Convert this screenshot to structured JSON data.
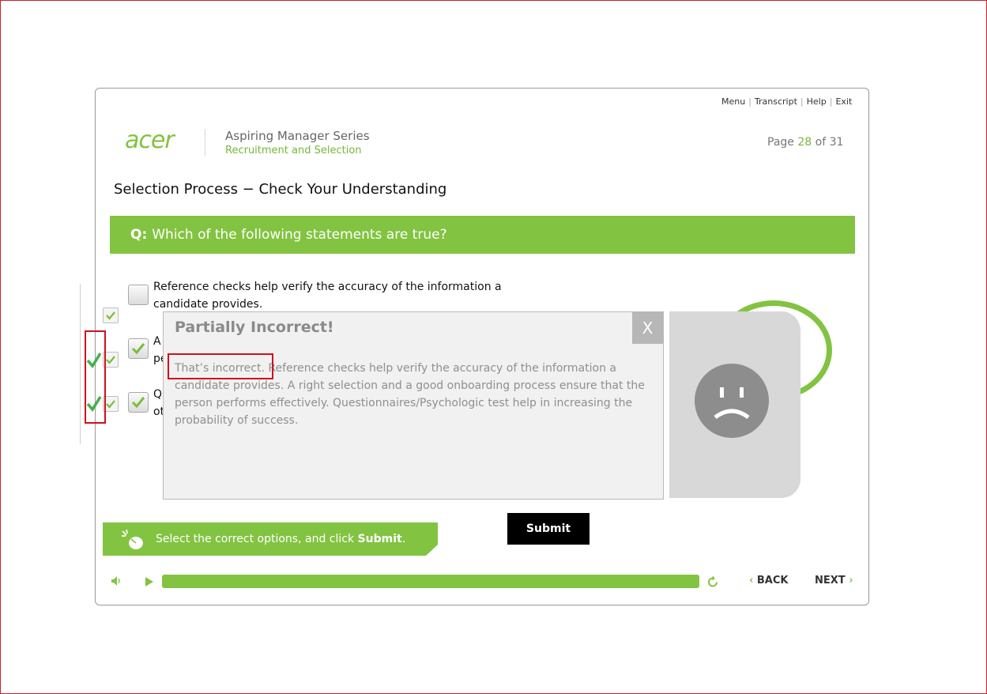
{
  "topnav": {
    "menu": "Menu",
    "transcript": "Transcript",
    "help": "Help",
    "exit": "Exit"
  },
  "brand": {
    "logo": "acer",
    "series": "Aspiring Manager Series",
    "module": "Recruitment and Selection"
  },
  "page": {
    "label": "Page",
    "current": "28",
    "of": "of",
    "total": "31"
  },
  "title": "Selection Process − Check Your Understanding",
  "question": {
    "prefix": "Q:",
    "text": "Which of the following statements are true?"
  },
  "options": [
    {
      "text": "Reference checks help verify the accuracy of the information a candidate provides.",
      "checked": false
    },
    {
      "text": "A\npe",
      "checked": true
    },
    {
      "text": "Q\not",
      "checked": true
    }
  ],
  "feedback": {
    "title": "Partially Incorrect!",
    "close": "X",
    "lead": "That’s incorrect.",
    "body": "Reference checks help verify the accuracy of the information a candidate provides. A right selection and a good onboarding process ensure that the person performs effectively. Questionnaires/Psychologic test help in increasing the probability of success."
  },
  "hint": {
    "before": "Select the correct options, and click ",
    "bold": "Submit",
    "after": "."
  },
  "submit": "Submit",
  "player": {
    "back": "BACK",
    "next": "NEXT",
    "progress": 1.0
  },
  "colors": {
    "accent": "#82c341",
    "highlight": "#d0101c"
  }
}
